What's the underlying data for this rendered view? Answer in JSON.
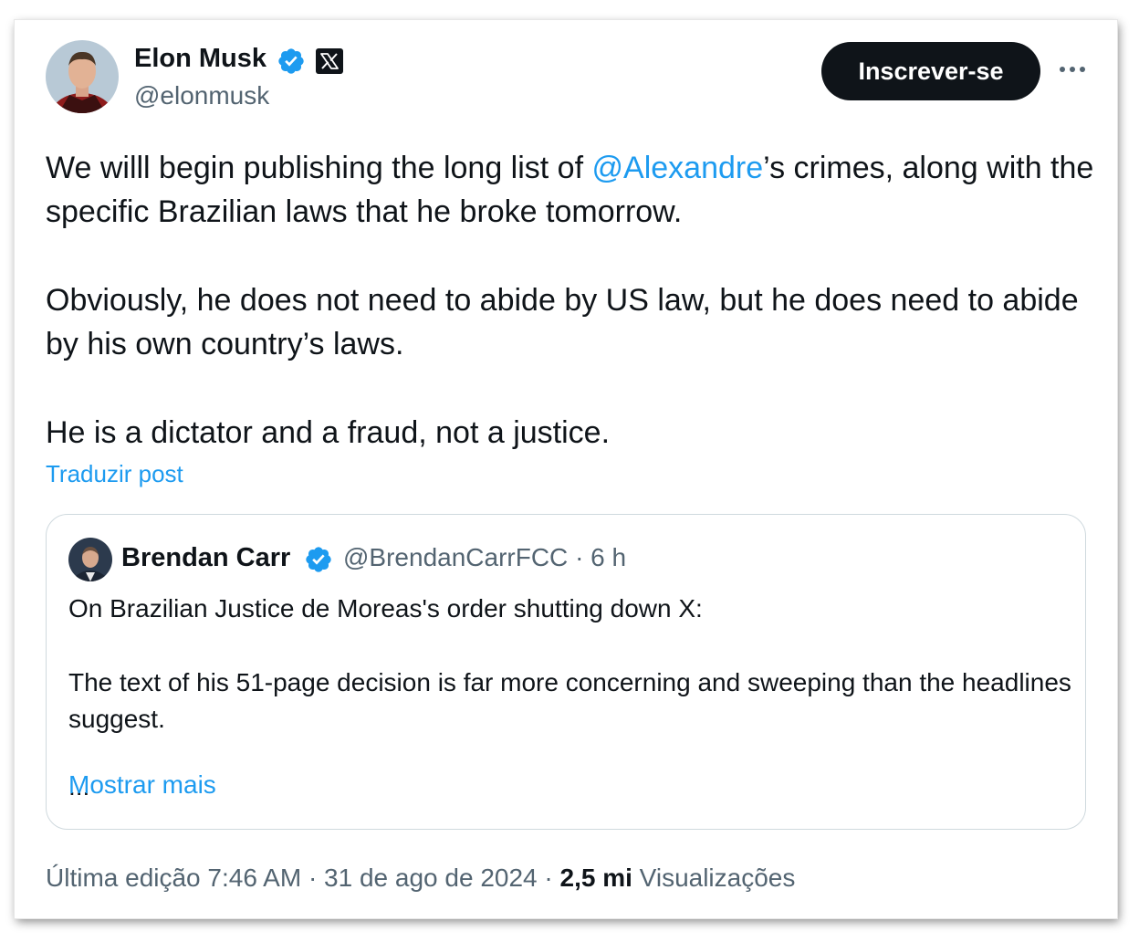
{
  "post": {
    "author": {
      "name": "Elon Musk",
      "handle": "@elonmusk",
      "verified": true,
      "affiliate_badge": "x-logo-icon",
      "avatar": "avatar-elon-musk"
    },
    "subscribe_label": "Inscrever-se",
    "more_icon": "more-horizontal-icon",
    "text": {
      "p1_before": "We willl begin publishing the long list of ",
      "p1_mention": "@Alexandre",
      "p1_after": "’s crimes, along with the specific Brazilian laws that he broke tomorrow.",
      "p2": "Obviously, he does not need to abide by US law, but he does need to abide by his own country’s laws.",
      "p3": "He is a dictator and a fraud, not a justice."
    },
    "translate_label": "Traduzir post",
    "quoted": {
      "author_name": "Brendan Carr",
      "verified": true,
      "handle": "@BrendanCarrFCC",
      "separator": "·",
      "time": "6 h",
      "p1": "On Brazilian Justice de Moreas's order shutting down X:",
      "p2": "The text of his 51-page decision is far more concerning and sweeping than the headlines suggest.",
      "ellipsis": "...",
      "show_more_label": "Mostrar mais"
    },
    "meta": {
      "edited_label": "Última edição",
      "time": "7:46 AM",
      "separator": "·",
      "date": "31 de ago de 2024",
      "views_count": "2,5 mi",
      "views_label": "Visualizações"
    }
  },
  "colors": {
    "accent": "#1d9bf0",
    "text": "#0f1419",
    "secondary_text": "#536471",
    "button_bg": "#0f1419",
    "border": "#cfd9de"
  }
}
